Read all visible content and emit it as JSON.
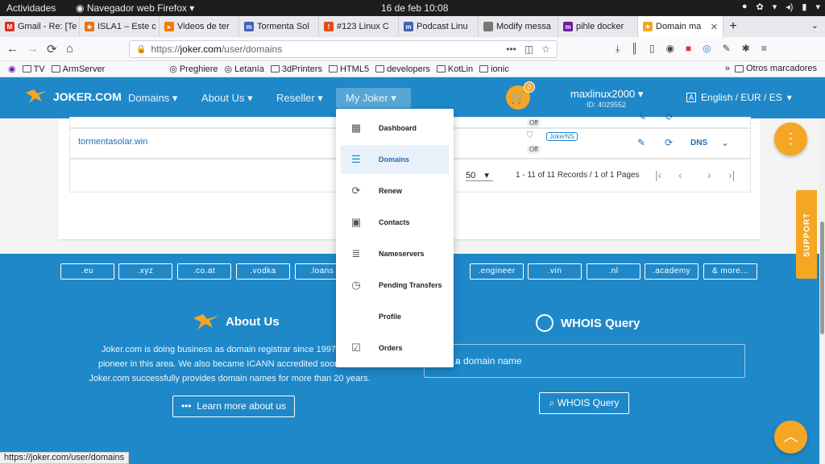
{
  "os": {
    "activities": "Actividades",
    "app_name": "Navegador web Firefox",
    "clock": "16 de feb  10:08"
  },
  "tabs": [
    {
      "label": "Gmail - Re: [Te",
      "color": "#d93025",
      "glyph": "M"
    },
    {
      "label": "ISLA1 – Este c",
      "color": "#e8710a",
      "glyph": "★"
    },
    {
      "label": "Videos de ter",
      "color": "#f57c00",
      "glyph": "▸"
    },
    {
      "label": "Tormenta Sol",
      "color": "#4062bb",
      "glyph": "m"
    },
    {
      "label": "#123 Linux C",
      "color": "#e64a19",
      "glyph": "!"
    },
    {
      "label": "Podcast Linu",
      "color": "#4062bb",
      "glyph": "m"
    },
    {
      "label": "Modify messa",
      "color": "#777777",
      "glyph": ""
    },
    {
      "label": "pihle docker",
      "color": "#6a1b9a",
      "glyph": "m"
    },
    {
      "label": "Domain ma",
      "color": "#f5a623",
      "glyph": "✦",
      "active": true
    }
  ],
  "browser": {
    "url_proto": "https://",
    "url_host": "joker.com",
    "url_path": "/user/domains",
    "status_url": "https://joker.com/user/domains"
  },
  "bookmarks": [
    {
      "label": "TV",
      "type": "folder"
    },
    {
      "label": "ArmServer",
      "type": "folder"
    },
    {
      "label": "Preghiere",
      "type": "globe"
    },
    {
      "label": "Letanía",
      "type": "globe"
    },
    {
      "label": "3dPrinters",
      "type": "folder"
    },
    {
      "label": "HTML5",
      "type": "folder"
    },
    {
      "label": "developers",
      "type": "folder"
    },
    {
      "label": "KotLin",
      "type": "folder"
    },
    {
      "label": "ionic",
      "type": "folder"
    }
  ],
  "bookmarks_other": "Otros marcadores",
  "site": {
    "logo": "JOKER.COM",
    "nav": [
      "Domains",
      "About Us",
      "Reseller",
      "My Joker"
    ],
    "cart_count": "0",
    "username": "maxlinux2000",
    "user_id": "ID: 4029552",
    "language": "English / EUR / ES"
  },
  "domains_table": {
    "domain": "tormentasolar.win",
    "ns_badge": "JokerNS",
    "off_label": "Off",
    "dns_label": "DNS",
    "per_page": "50",
    "records": "1 - 11 of 11 Records / 1 of 1 Pages"
  },
  "menu": [
    {
      "label": "Dashboard",
      "icon": "dashboard-icon",
      "glyph": "▦"
    },
    {
      "label": "Domains",
      "icon": "list-icon",
      "glyph": "☰",
      "active": true
    },
    {
      "label": "Renew",
      "icon": "renew-icon",
      "glyph": "⟳"
    },
    {
      "label": "Contacts",
      "icon": "contacts-icon",
      "glyph": "▣"
    },
    {
      "label": "Nameservers",
      "icon": "server-icon",
      "glyph": "≣"
    },
    {
      "label": "Pending Transfers",
      "icon": "clock-icon",
      "glyph": "◷"
    },
    {
      "label": "Profile",
      "icon": "",
      "glyph": ""
    },
    {
      "label": "Orders",
      "icon": "checklist-icon",
      "glyph": "☑"
    }
  ],
  "support": "SUPPORT",
  "tlds": [
    ".eu",
    ".xyz",
    ".co.at",
    ".vodka",
    ".loans",
    ".engineer",
    ".vin",
    ".nl",
    ".academy",
    "& more..."
  ],
  "about": {
    "title": "About Us",
    "text_1": "Joker.com is doing business as domain registrar since 1997, thus",
    "text_2": "pioneer in this area. We also became ICANN accredited soon in 20",
    "text_3": "Joker.com successfully provides domain names for more than 20 years.",
    "button": "Learn more about us"
  },
  "whois": {
    "title": "WHOIS Query",
    "placeholder": "a domain name",
    "button": "WHOIS Query"
  },
  "colors": {
    "brand_blue": "#1e88c9",
    "accent_orange": "#f5a623"
  }
}
